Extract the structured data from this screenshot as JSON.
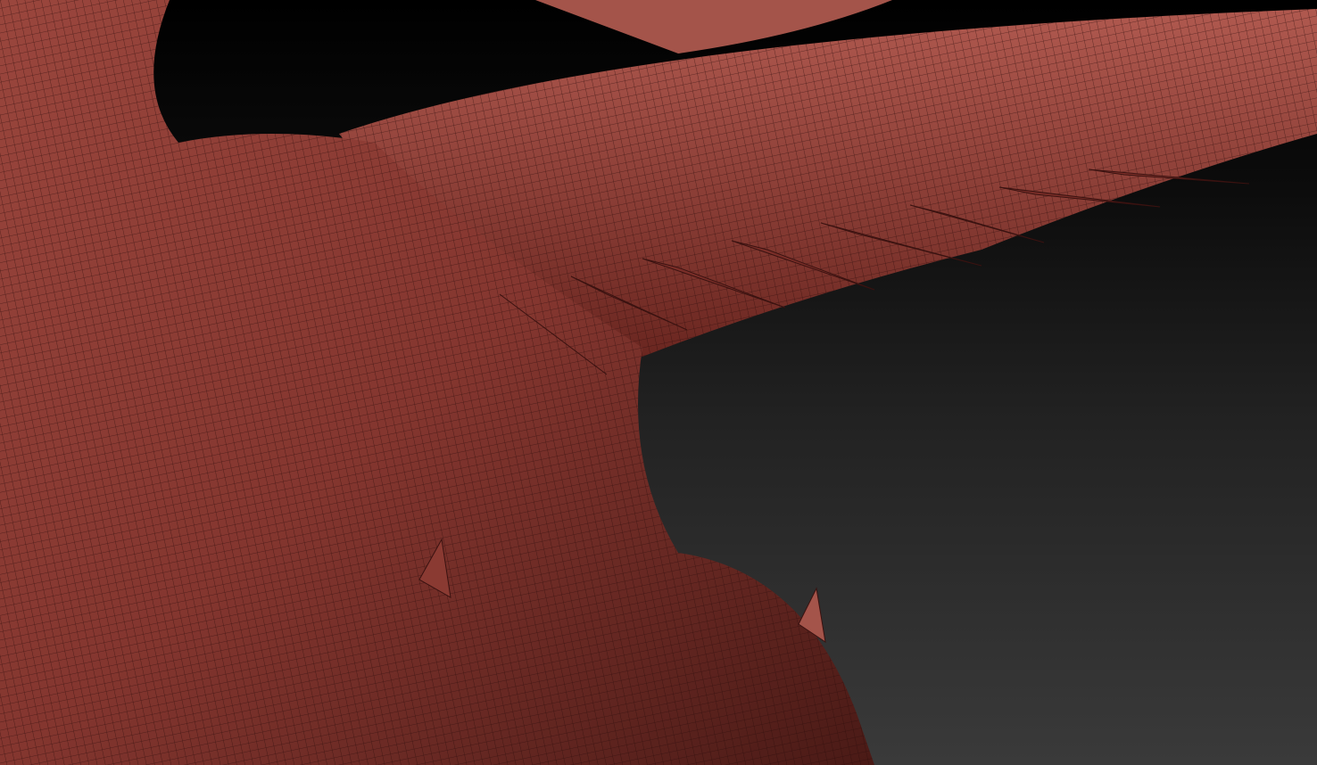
{
  "scene": {
    "subject": "dragon-mesh",
    "colors": {
      "background_top": "#000000",
      "background_bottom": "#3a3a3a",
      "mesh_base": "#8a3a32",
      "mesh_light": "#b8625a",
      "mesh_dark": "#3a1210",
      "wire": "#2a0c0a"
    }
  }
}
